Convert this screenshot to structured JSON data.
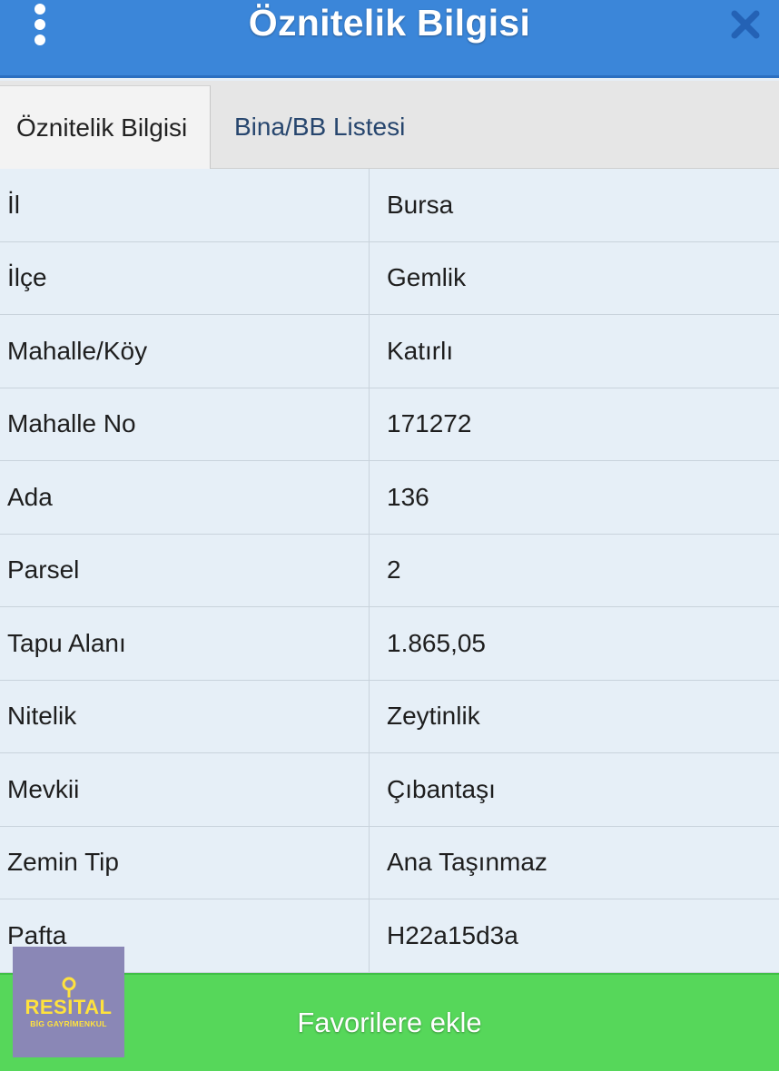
{
  "header": {
    "title": "Öznitelik Bilgisi",
    "menu_icon": "more-vertical-icon",
    "close_icon": "close-icon"
  },
  "tabs": [
    {
      "label": "Öznitelik Bilgisi",
      "active": true
    },
    {
      "label": "Bina/BB Listesi",
      "active": false
    }
  ],
  "table": {
    "rows": [
      {
        "key": "İl",
        "value": "Bursa"
      },
      {
        "key": "İlçe",
        "value": "Gemlik"
      },
      {
        "key": "Mahalle/Köy",
        "value": "Katırlı"
      },
      {
        "key": "Mahalle No",
        "value": "171272"
      },
      {
        "key": "Ada",
        "value": "136"
      },
      {
        "key": "Parsel",
        "value": "2"
      },
      {
        "key": "Tapu Alanı",
        "value": "1.865,05"
      },
      {
        "key": "Nitelik",
        "value": "Zeytinlik"
      },
      {
        "key": "Mevkii",
        "value": "Çıbantaşı"
      },
      {
        "key": "Zemin Tip",
        "value": "Ana Taşınmaz"
      },
      {
        "key": "Pafta",
        "value": "H22a15d3a"
      }
    ]
  },
  "footer": {
    "button_label": "Favorilere ekle"
  },
  "logo": {
    "name": "RESITAL",
    "subtitle": "BİG GAYRİMENKUL"
  },
  "colors": {
    "header_bg": "#3b86d9",
    "footer_bg": "#56d75a",
    "table_bg": "#e6eff7",
    "logo_bg": "#8a87b6",
    "logo_text": "#ffe23d"
  }
}
